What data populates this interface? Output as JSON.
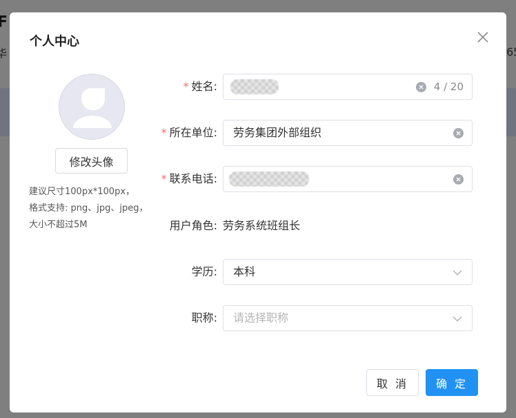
{
  "dialog": {
    "title": "个人中心"
  },
  "avatar": {
    "change_button": "修改头像",
    "hint_lines": [
      "建议尺寸100px*100px，",
      "格式支持: png、jpg、jpeg，",
      "大小不超过5M"
    ]
  },
  "form": {
    "name": {
      "label": "姓名:",
      "counter": "4 / 20"
    },
    "unit": {
      "label": "所在单位:",
      "value": "劳务集团外部组织"
    },
    "phone": {
      "label": "联系电话:"
    },
    "role": {
      "label": "用户角色:",
      "value": "劳务系统班组长"
    },
    "education": {
      "label": "学历:",
      "value": "本科"
    },
    "title": {
      "label": "职称:",
      "placeholder": "请选择职称"
    }
  },
  "footer": {
    "cancel": "取 消",
    "confirm": "确 定"
  },
  "colors": {
    "primary": "#2192f4",
    "required": "#f56c6c"
  }
}
